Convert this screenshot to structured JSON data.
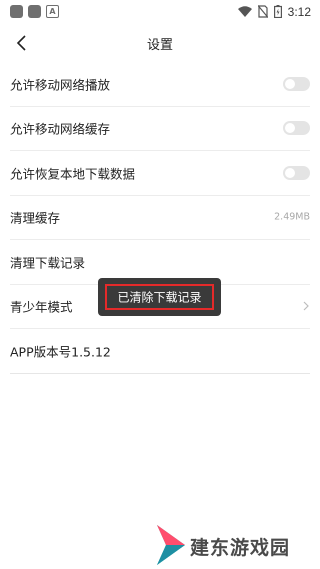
{
  "status_bar": {
    "time": "3:12",
    "icons": [
      "app-icon",
      "app-icon",
      "text-app-icon",
      "wifi-icon",
      "no-sim-icon",
      "battery-icon"
    ],
    "left_letter": "A"
  },
  "header": {
    "title": "设置",
    "back_icon": "chevron-left-icon"
  },
  "settings": {
    "items": [
      {
        "label": "允许移动网络播放",
        "control": "toggle",
        "on": false
      },
      {
        "label": "允许移动网络缓存",
        "control": "toggle",
        "on": false
      },
      {
        "label": "允许恢复本地下载数据",
        "control": "toggle",
        "on": false
      },
      {
        "label": "清理缓存",
        "value": "2.49MB"
      },
      {
        "label": "清理下载记录"
      },
      {
        "label": "青少年模式",
        "control": "chevron-right-icon"
      },
      {
        "label": "APP版本号1.5.12"
      }
    ]
  },
  "toast": {
    "text": "已清除下载记录",
    "highlight_color": "#e52a2a"
  },
  "watermark": {
    "text": "建东游戏园"
  },
  "colors": {
    "toggle_off": "#e4e4e4",
    "toast_bg": "#3a3a3a"
  }
}
